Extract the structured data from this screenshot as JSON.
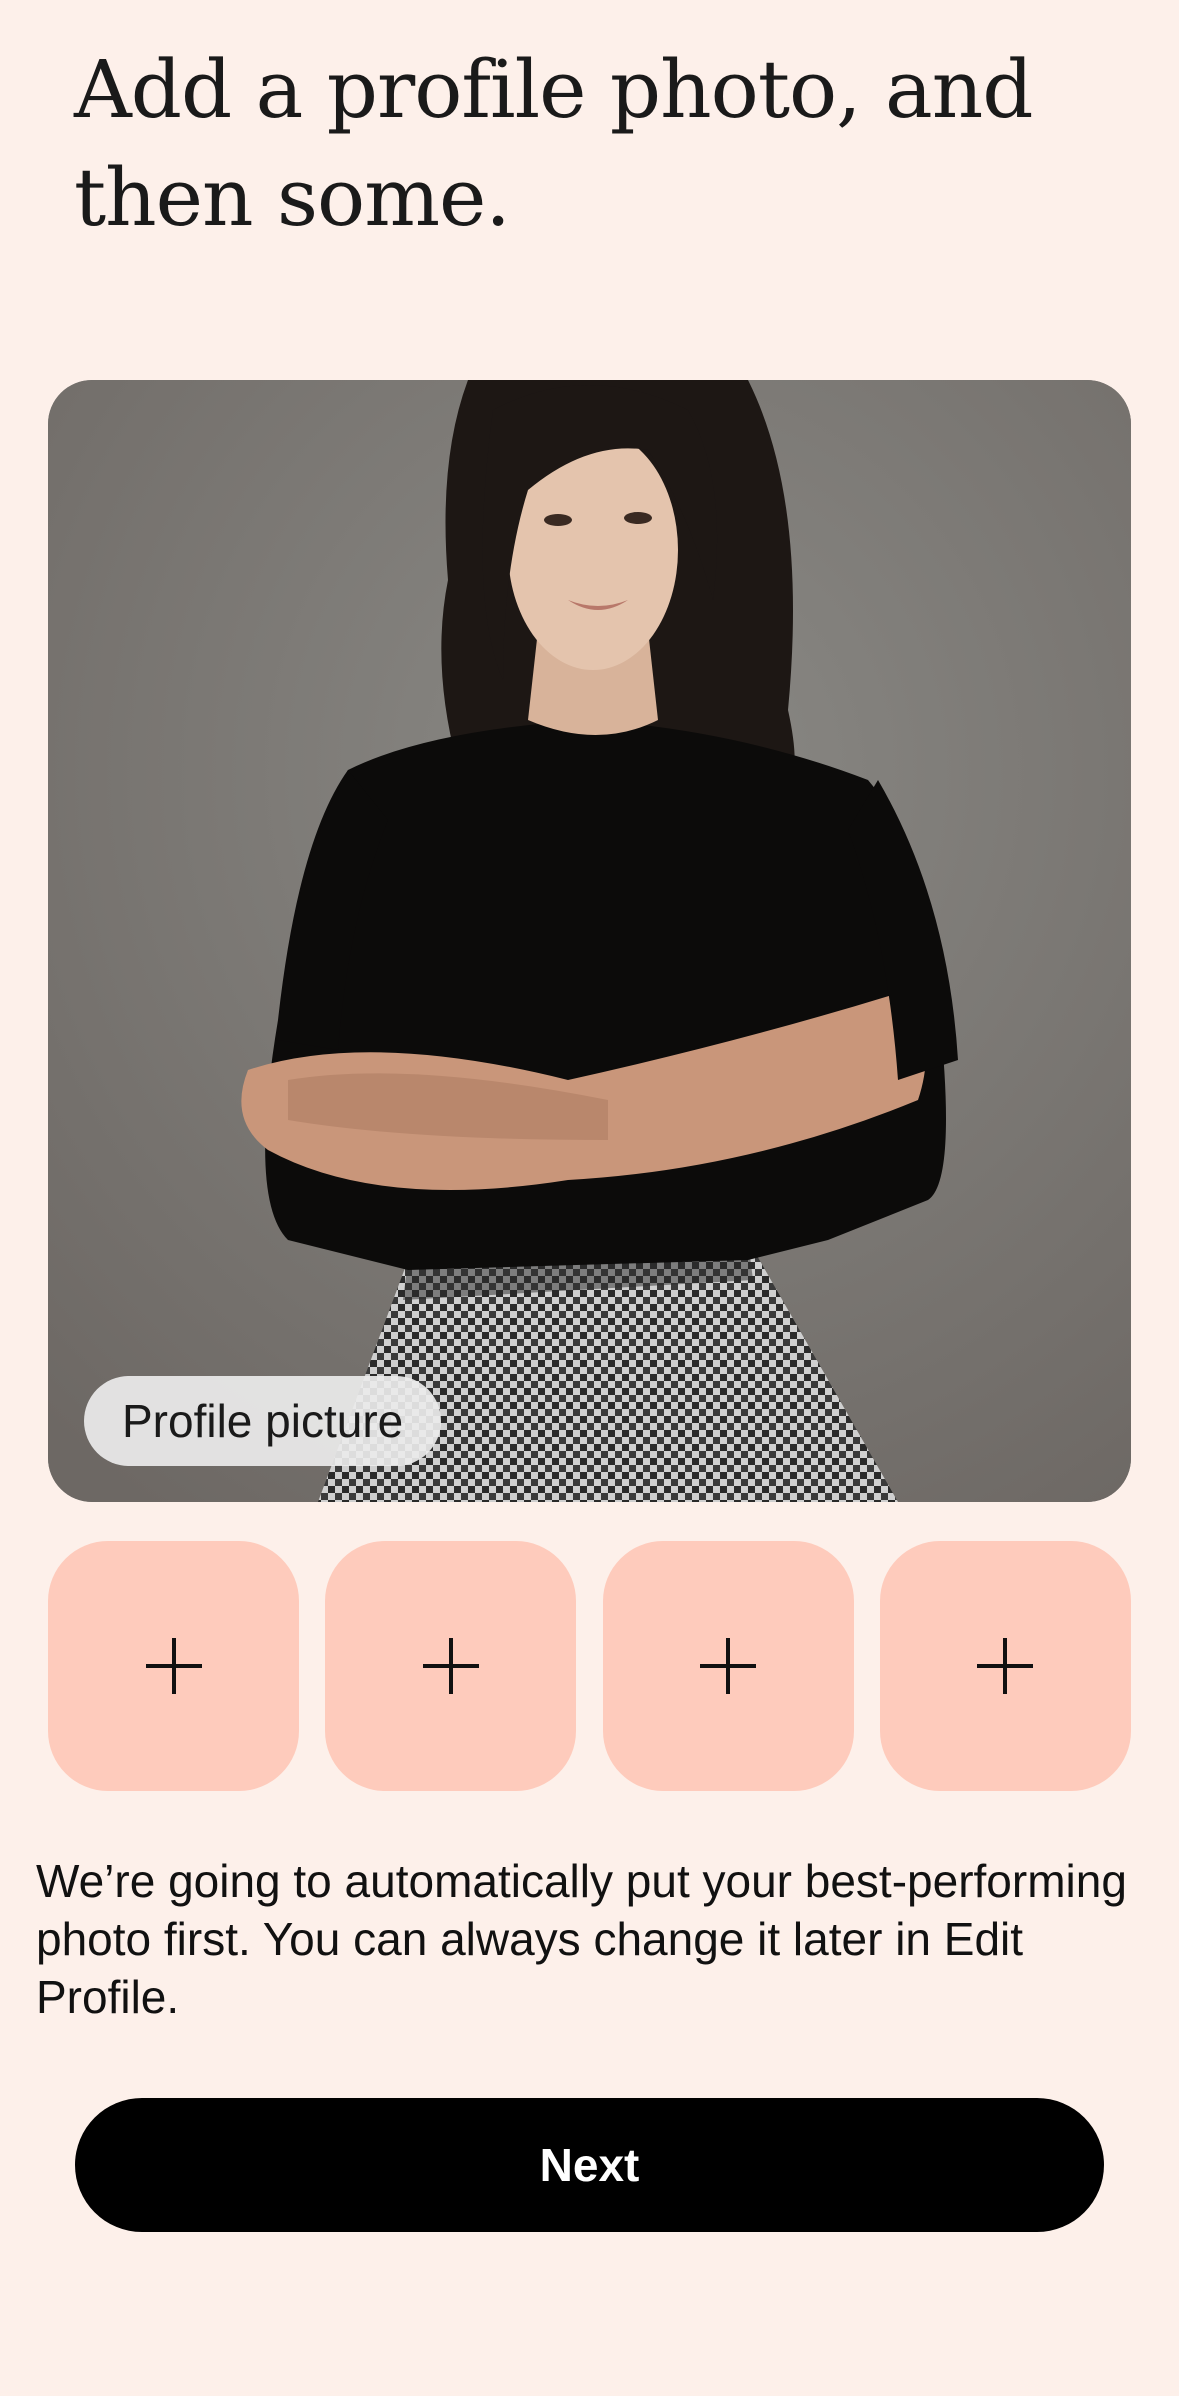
{
  "header": {
    "title_line1": "Add a profile photo, and",
    "title_line2": "then some."
  },
  "main_photo": {
    "label": "Profile picture"
  },
  "photo_slots": [
    {
      "icon": "plus-icon"
    },
    {
      "icon": "plus-icon"
    },
    {
      "icon": "plus-icon"
    },
    {
      "icon": "plus-icon"
    }
  ],
  "description": "We’re going to automatically put your best-performing photo first. You can always change it later in Edit Profile.",
  "footer": {
    "next_label": "Next"
  },
  "colors": {
    "background": "#fdf0ea",
    "slot": "#fecbbc",
    "button": "#000000"
  }
}
